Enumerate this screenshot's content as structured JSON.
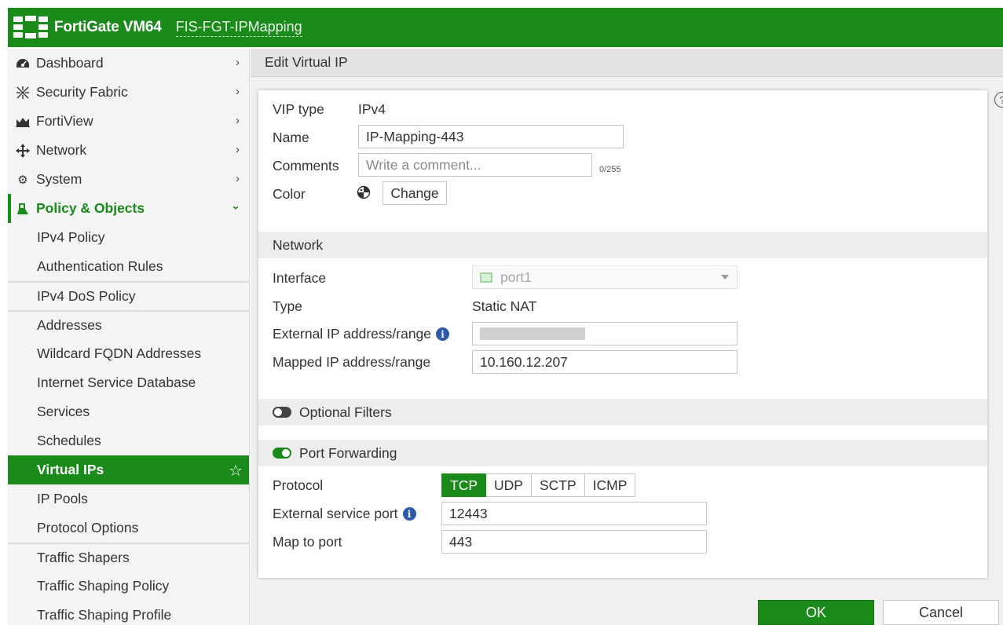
{
  "header": {
    "brand": "FortiGate VM64",
    "hostname": "FIS-FGT-IPMapping",
    "color": "#1a8a1a"
  },
  "sidebar": {
    "items": [
      {
        "label": "Dashboard",
        "icon": "dashboard-icon"
      },
      {
        "label": "Security Fabric",
        "icon": "security-fabric-icon"
      },
      {
        "label": "FortiView",
        "icon": "fortiview-icon"
      },
      {
        "label": "Network",
        "icon": "network-icon"
      },
      {
        "label": "System",
        "icon": "gear-icon"
      },
      {
        "label": "Policy & Objects",
        "icon": "policy-icon"
      }
    ],
    "subitems": [
      {
        "label": "IPv4 Policy"
      },
      {
        "label": "Authentication Rules"
      },
      {
        "label": "IPv4 DoS Policy"
      },
      {
        "label": "Addresses"
      },
      {
        "label": "Wildcard FQDN Addresses"
      },
      {
        "label": "Internet Service Database"
      },
      {
        "label": "Services"
      },
      {
        "label": "Schedules"
      },
      {
        "label": "Virtual IPs"
      },
      {
        "label": "IP Pools"
      },
      {
        "label": "Protocol Options"
      },
      {
        "label": "Traffic Shapers"
      },
      {
        "label": "Traffic Shaping Policy"
      },
      {
        "label": "Traffic Shaping Profile"
      }
    ]
  },
  "page": {
    "title": "Edit Virtual IP",
    "help": "?"
  },
  "form": {
    "vip_type_label": "VIP type",
    "vip_type_value": "IPv4",
    "name_label": "Name",
    "name_value": "IP-Mapping-443",
    "comments_label": "Comments",
    "comments_placeholder": "Write a comment...",
    "comments_counter": "0/255",
    "color_label": "Color",
    "change_label": "Change"
  },
  "network": {
    "section_title": "Network",
    "interface_label": "Interface",
    "interface_value": "port1",
    "type_label": "Type",
    "type_value": "Static NAT",
    "external_ip_label": "External IP address/range",
    "mapped_ip_label": "Mapped IP address/range",
    "mapped_ip_value": "10.160.12.207"
  },
  "optional_filters": {
    "label": "Optional Filters",
    "enabled": false
  },
  "port_forwarding": {
    "label": "Port Forwarding",
    "enabled": true,
    "protocol_label": "Protocol",
    "protocols": [
      "TCP",
      "UDP",
      "SCTP",
      "ICMP"
    ],
    "selected_protocol": "TCP",
    "external_port_label": "External service port",
    "external_port_value": "12443",
    "map_port_label": "Map to port",
    "map_port_value": "443"
  },
  "footer": {
    "ok_label": "OK",
    "cancel_label": "Cancel"
  }
}
